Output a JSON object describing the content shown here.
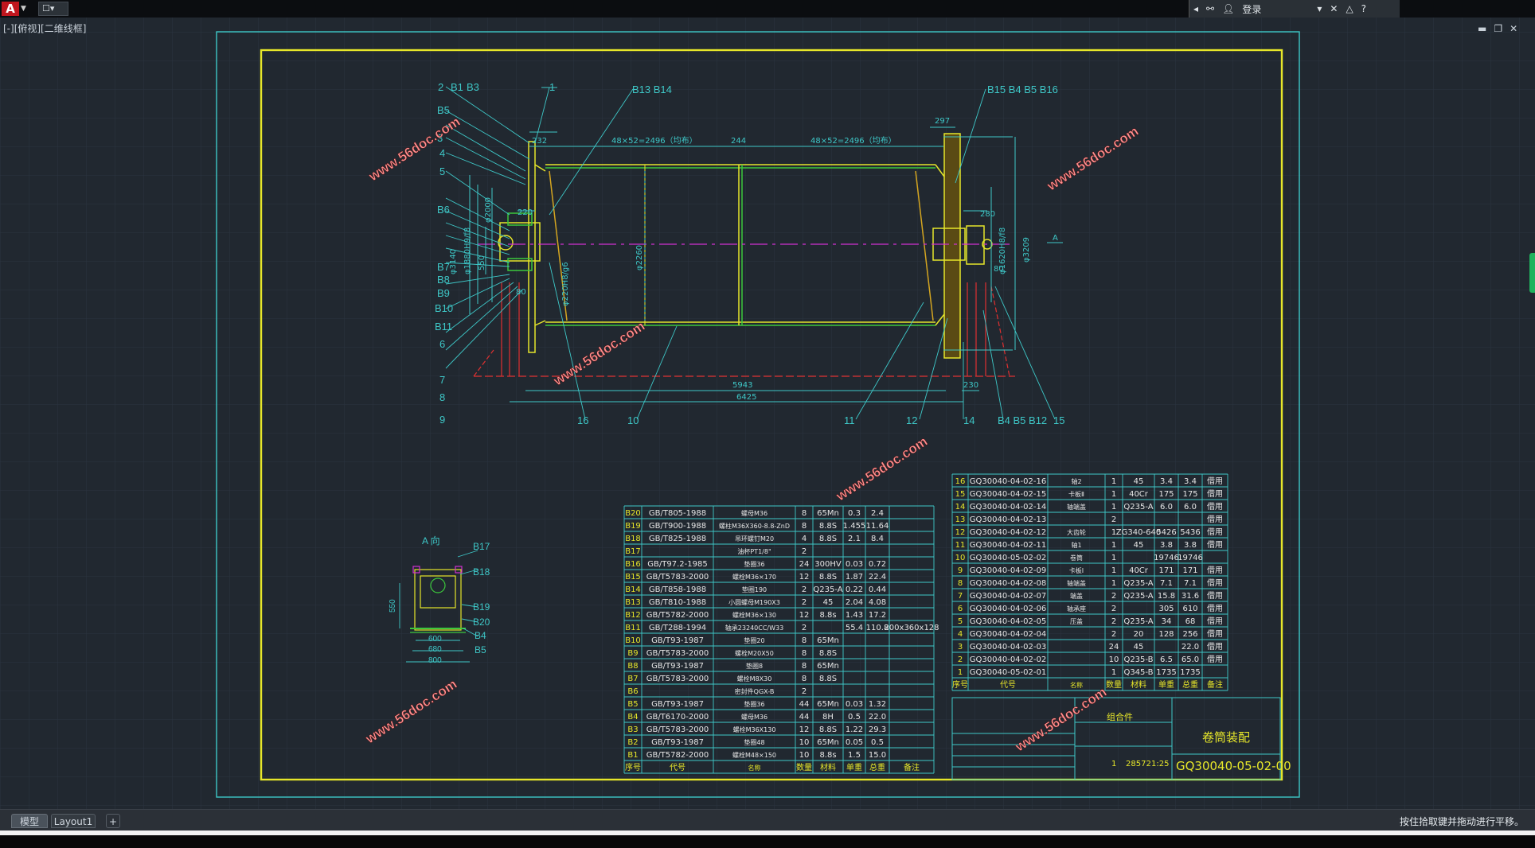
{
  "app": {
    "logo": "A",
    "quick_access": "☐▾",
    "user_button": "登录"
  },
  "viewport": {
    "label": "[-][俯视][二维线框]"
  },
  "tabs": {
    "model": "模型",
    "layout1": "Layout1",
    "add": "+"
  },
  "status_text": "按住拾取键并拖动进行平移。",
  "drawing": {
    "watermark": "www.56doc.com",
    "title_block": {
      "assembly": "卷筒装配",
      "drawing_no": "GQ30040-05-02-00",
      "group_label": "组合件",
      "weight": "28572",
      "scale": "1:25",
      "qty": "1"
    },
    "view_a_label": "A 向",
    "view_a_dims": [
      "600",
      "680",
      "800",
      "550"
    ],
    "main_dims": {
      "d1": "48×52=2496（均布）",
      "d2": "244",
      "d3": "48×52=2496（均布）",
      "d4": "297",
      "d5": "232",
      "d6": "220",
      "d7": "280",
      "d8": "5943",
      "d9": "6425",
      "d10": "230",
      "d11": "φ2260",
      "d12": "φ3209",
      "d13": "φ1620H8/f8",
      "d14": "φ3140",
      "d15": "φ1880H9/f8",
      "d16": "φ2000",
      "d17": "φ220H8/g6",
      "d18": "550",
      "d19": "80",
      "d20": "80",
      "d21": "A"
    },
    "balloons_left": [
      "2",
      "B1",
      "B3",
      "B5",
      "3",
      "4",
      "5",
      "B6",
      "B7",
      "B8",
      "B9",
      "B10",
      "B11",
      "6",
      "7",
      "8",
      "9"
    ],
    "balloons_top": [
      "1",
      "B13 B14",
      "B15 B4 B5 B16"
    ],
    "balloons_bottom": [
      "16",
      "10",
      "11",
      "12",
      "14",
      "B4 B5 B12",
      "15"
    ],
    "view_a_balloons": [
      "B17",
      "B18",
      "B19",
      "B20",
      "B4",
      "B5"
    ],
    "std_parts_header": [
      "序号",
      "代号",
      "名称",
      "数量",
      "材料",
      "单重",
      "总重",
      "备注"
    ],
    "std_parts": [
      [
        "B20",
        "GB/T805-1988",
        "螺母M36",
        "8",
        "65Mn",
        "0.3",
        "2.4",
        ""
      ],
      [
        "B19",
        "GB/T900-1988",
        "螺柱M36X360-8.8-ZnD",
        "8",
        "8.8S",
        "1.455",
        "11.64",
        ""
      ],
      [
        "B18",
        "GB/T825-1988",
        "吊环螺钉M20",
        "4",
        "8.8S",
        "2.1",
        "8.4",
        ""
      ],
      [
        "B17",
        "",
        "油杯PT1/8\"",
        "2",
        "",
        "",
        "",
        ""
      ],
      [
        "B16",
        "GB/T97.2-1985",
        "垫圈36",
        "24",
        "300HV",
        "0.03",
        "0.72",
        ""
      ],
      [
        "B15",
        "GB/T5783-2000",
        "螺栓M36×170",
        "12",
        "8.8S",
        "1.87",
        "22.4",
        ""
      ],
      [
        "B14",
        "GB/T858-1988",
        "垫圈190",
        "2",
        "Q235-A",
        "0.22",
        "0.44",
        ""
      ],
      [
        "B13",
        "GB/T810-1988",
        "小圆螺母M190X3",
        "2",
        "45",
        "2.04",
        "4.08",
        ""
      ],
      [
        "B12",
        "GB/T5782-2000",
        "螺栓M36×130",
        "12",
        "8.8s",
        "1.43",
        "17.2",
        ""
      ],
      [
        "B11",
        "GB/T288-1994",
        "轴承23240CC/W33",
        "2",
        "",
        "55.4",
        "110.8",
        "200x360x128"
      ],
      [
        "B10",
        "GB/T93-1987",
        "垫圈20",
        "8",
        "65Mn",
        "",
        "",
        ""
      ],
      [
        "B9",
        "GB/T5783-2000",
        "螺栓M20X50",
        "8",
        "8.8S",
        "",
        "",
        ""
      ],
      [
        "B8",
        "GB/T93-1987",
        "垫圈8",
        "8",
        "65Mn",
        "",
        "",
        ""
      ],
      [
        "B7",
        "GB/T5783-2000",
        "螺栓M8X30",
        "8",
        "8.8S",
        "",
        "",
        ""
      ],
      [
        "B6",
        "",
        "密封件QGX-B",
        "2",
        "",
        "",
        "",
        ""
      ],
      [
        "B5",
        "GB/T93-1987",
        "垫圈36",
        "44",
        "65Mn",
        "0.03",
        "1.32",
        ""
      ],
      [
        "B4",
        "GB/T6170-2000",
        "螺母M36",
        "44",
        "8H",
        "0.5",
        "22.0",
        ""
      ],
      [
        "B3",
        "GB/T5783-2000",
        "螺栓M36X130",
        "12",
        "8.8S",
        "1.22",
        "29.3",
        ""
      ],
      [
        "B2",
        "GB/T93-1987",
        "垫圈48",
        "10",
        "65Mn",
        "0.05",
        "0.5",
        ""
      ],
      [
        "B1",
        "GB/T5782-2000",
        "螺栓M48×150",
        "10",
        "8.8s",
        "1.5",
        "15.0",
        ""
      ]
    ],
    "parts": [
      [
        "16",
        "GQ30040-04-02-16",
        "轴2",
        "1",
        "45",
        "3.4",
        "3.4",
        "借用"
      ],
      [
        "15",
        "GQ30040-04-02-15",
        "卡板Ⅱ",
        "1",
        "40Cr",
        "175",
        "175",
        "借用"
      ],
      [
        "14",
        "GQ30040-04-02-14",
        "轴端盖",
        "1",
        "Q235-A",
        "6.0",
        "6.0",
        "借用"
      ],
      [
        "13",
        "GQ30040-04-02-13",
        "",
        "2",
        "",
        "",
        "",
        "借用"
      ],
      [
        "12",
        "GQ30040-04-02-12",
        "大齿轮",
        "1",
        "ZG340-640",
        "5426",
        "5436",
        "借用"
      ],
      [
        "11",
        "GQ30040-04-02-11",
        "轴1",
        "1",
        "45",
        "3.8",
        "3.8",
        "借用"
      ],
      [
        "10",
        "GQ30040-05-02-02",
        "卷筒",
        "1",
        "",
        "19746",
        "19746",
        ""
      ],
      [
        "9",
        "GQ30040-04-02-09",
        "卡板Ⅰ",
        "1",
        "40Cr",
        "171",
        "171",
        "借用"
      ],
      [
        "8",
        "GQ30040-04-02-08",
        "轴端盖",
        "1",
        "Q235-A",
        "7.1",
        "7.1",
        "借用"
      ],
      [
        "7",
        "GQ30040-04-02-07",
        "端盖",
        "2",
        "Q235-A",
        "15.8",
        "31.6",
        "借用"
      ],
      [
        "6",
        "GQ30040-04-02-06",
        "轴承座",
        "2",
        "",
        "305",
        "610",
        "借用"
      ],
      [
        "5",
        "GQ30040-04-02-05",
        "压盖",
        "2",
        "Q235-A",
        "34",
        "68",
        "借用"
      ],
      [
        "4",
        "GQ30040-04-02-04",
        "",
        "2",
        "20",
        "128",
        "256",
        "借用"
      ],
      [
        "3",
        "GQ30040-04-02-03",
        "",
        "24",
        "45",
        "",
        "22.0",
        "借用"
      ],
      [
        "2",
        "GQ30040-04-02-02",
        "",
        "10",
        "Q235-B",
        "6.5",
        "65.0",
        "借用"
      ],
      [
        "1",
        "GQ30040-05-02-01",
        "",
        "1",
        "Q345-B",
        "1735",
        "1735",
        ""
      ]
    ],
    "parts_header": [
      "序号",
      "代号",
      "名称",
      "数量",
      "材料",
      "单重",
      "总重",
      "备注"
    ]
  }
}
